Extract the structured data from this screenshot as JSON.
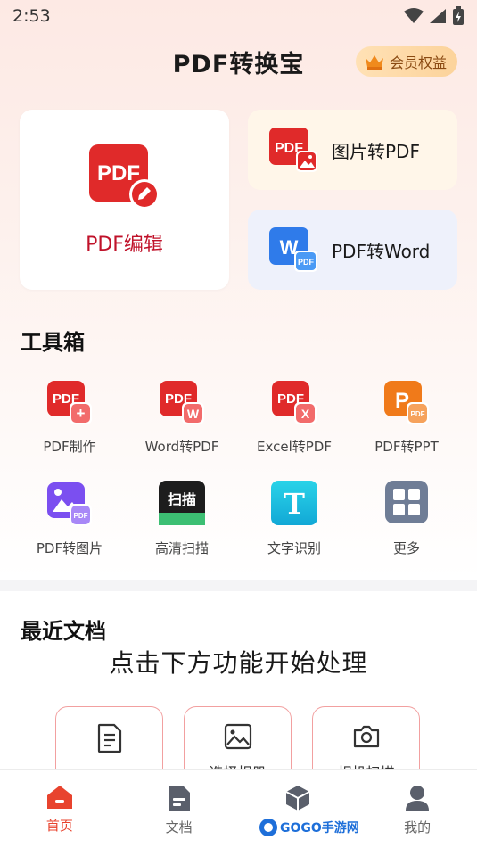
{
  "status_bar": {
    "time": "2:53"
  },
  "header": {
    "title": "PDF转换宝",
    "vip_label": "会员权益"
  },
  "hero": {
    "label": "PDF编辑",
    "icon_text": "PDF"
  },
  "cards": [
    {
      "label": "图片转PDF",
      "icon_text": "PDF"
    },
    {
      "label": "PDF转Word",
      "icon_text": "W",
      "badge": "PDF"
    }
  ],
  "toolbox": {
    "title": "工具箱",
    "items": [
      {
        "label": "PDF制作",
        "icon": "pdf-create-icon",
        "text": "PDF",
        "badge": "+"
      },
      {
        "label": "Word转PDF",
        "icon": "word-to-pdf-icon",
        "text": "PDF",
        "badge": "W"
      },
      {
        "label": "Excel转PDF",
        "icon": "excel-to-pdf-icon",
        "text": "PDF",
        "badge": "X"
      },
      {
        "label": "PDF转PPT",
        "icon": "pdf-to-ppt-icon",
        "text": "P",
        "badge": "PDF"
      },
      {
        "label": "PDF转图片",
        "icon": "pdf-to-image-icon",
        "badge": "PDF"
      },
      {
        "label": "高清扫描",
        "icon": "scan-icon",
        "text": "扫描"
      },
      {
        "label": "文字识别",
        "icon": "ocr-icon",
        "text": "T"
      },
      {
        "label": "更多",
        "icon": "more-grid-icon"
      }
    ]
  },
  "recent": {
    "title": "最近文档",
    "empty_text": "点击下方功能开始处理",
    "actions": [
      {
        "label": "选择文档"
      },
      {
        "label": "选择相册"
      },
      {
        "label": "相机扫描"
      }
    ]
  },
  "bottom_nav": [
    {
      "label": "首页"
    },
    {
      "label": "文档"
    },
    {
      "label": ""
    },
    {
      "label": "我的"
    }
  ],
  "watermark": "GOGO手游网",
  "colors": {
    "accent": "#e8432e",
    "pdf_red": "#e02a2a",
    "hero_label": "#c0122a"
  }
}
